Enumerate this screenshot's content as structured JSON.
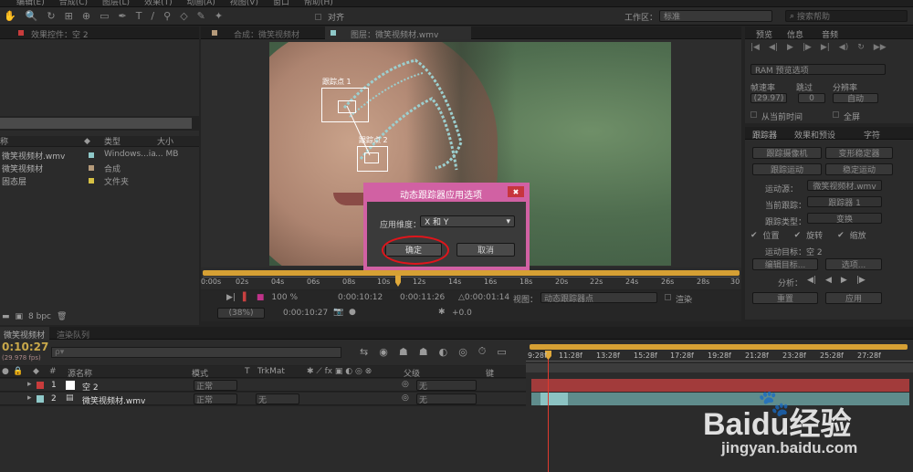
{
  "menu": [
    "编辑(E)",
    "合成(C)",
    "图层(L)",
    "效果(T)",
    "动画(A)",
    "视图(V)",
    "窗口",
    "帮助(H)"
  ],
  "toolbar": {
    "snap": "对齐",
    "workspace_label": "工作区：",
    "workspace_value": "标准",
    "search_placeholder": "搜索帮助"
  },
  "effects_panel": {
    "tab": "效果控件：空 2"
  },
  "project": {
    "col_name": "称",
    "col_type": "类型",
    "col_size": "大小",
    "items": [
      {
        "name": "微笑视频材.wmv",
        "type": "Windows...ia",
        "size": "... MB",
        "color": "#8fc9c9"
      },
      {
        "name": "微笑视频材",
        "type": "合成",
        "size": "",
        "color": "#b59a7a"
      },
      {
        "name": "固态层",
        "type": "文件夹",
        "size": "",
        "color": "#d7c144"
      }
    ],
    "bpc": "8 bpc"
  },
  "viewer": {
    "tab_comp": "合成：微笑视频材",
    "tab_layer": "图层：微笑视频材.wmv",
    "tracker1": "跟踪点 1",
    "tracker2": "跟踪点 2",
    "ruler": [
      "0:00s",
      "02s",
      "04s",
      "06s",
      "08s",
      "10s",
      "12s",
      "14s",
      "16s",
      "18s",
      "20s",
      "22s",
      "24s",
      "26s",
      "28s",
      "30"
    ],
    "zoom": "100 %",
    "time_in": "0:00:10:12",
    "time_out": "0:00:11:26",
    "duration": "△0:00:01:14",
    "view_label": "视图：",
    "view_value": "动态跟踪器点",
    "render": "渲染",
    "bottom_zoom": "(38%)",
    "timecode": "0:00:10:27",
    "exposure": "+0.0"
  },
  "dialog": {
    "title": "动态跟踪器应用选项",
    "dim_label": "应用维度：",
    "dim_value": "X 和 Y",
    "ok": "确定",
    "cancel": "取消",
    "close": "✖"
  },
  "preview": {
    "tabs": [
      "预览",
      "信息",
      "音频"
    ],
    "ram": "RAM 预览选项",
    "frame_rate": "帧速率",
    "skip": "跳过",
    "resolution": "分辨率",
    "frame_rate_value": "(29.97)",
    "skip_value": "0",
    "res_value": "自动",
    "from_current": "从当前时间",
    "full_screen": "全屏"
  },
  "tracker": {
    "tabs": [
      "跟踪器",
      "效果和预设",
      "字符"
    ],
    "track_camera": "跟踪摄像机",
    "warp_stabilizer": "变形稳定器",
    "track_motion": "跟踪运动",
    "stabilize_motion": "稳定运动",
    "motion_source_label": "运动源：",
    "motion_source": "微笑视频材.wmv",
    "current_track_label": "当前跟踪：",
    "current_track": "跟踪器 1",
    "track_type_label": "跟踪类型：",
    "track_type": "变换",
    "position": "位置",
    "rotation": "旋转",
    "scale": "缩放",
    "motion_target": "运动目标：空 2",
    "edit_target": "编辑目标...",
    "options": "选项...",
    "analyze": "分析：",
    "reset": "重置",
    "apply": "应用"
  },
  "timeline": {
    "tabs": [
      "微笑视频材",
      "渲染队列"
    ],
    "timecode": "0:10:27",
    "fps": "(29.978 fps)",
    "search_placeholder": "ρ▾",
    "col_num": "#",
    "col_name": "源名称",
    "col_mode": "模式",
    "col_t": "T",
    "col_trkmat": "TrkMat",
    "col_parent": "父级",
    "col_key": "键",
    "ruler": [
      "9:28f",
      "11:28f",
      "13:28f",
      "15:28f",
      "17:28f",
      "19:28f",
      "21:28f",
      "23:28f",
      "25:28f",
      "27:28f"
    ],
    "layers": [
      {
        "num": "1",
        "name": "空 2",
        "mode": "正常",
        "trkmat": "",
        "parent": "无",
        "color": "#c83c3c"
      },
      {
        "num": "2",
        "name": "微笑视频材.wmv",
        "mode": "正常",
        "trkmat": "无",
        "parent": "无",
        "color": "#8fc9c9"
      }
    ]
  },
  "watermark": {
    "brand": "Baidu经验",
    "url": "jingyan.baidu.com"
  }
}
